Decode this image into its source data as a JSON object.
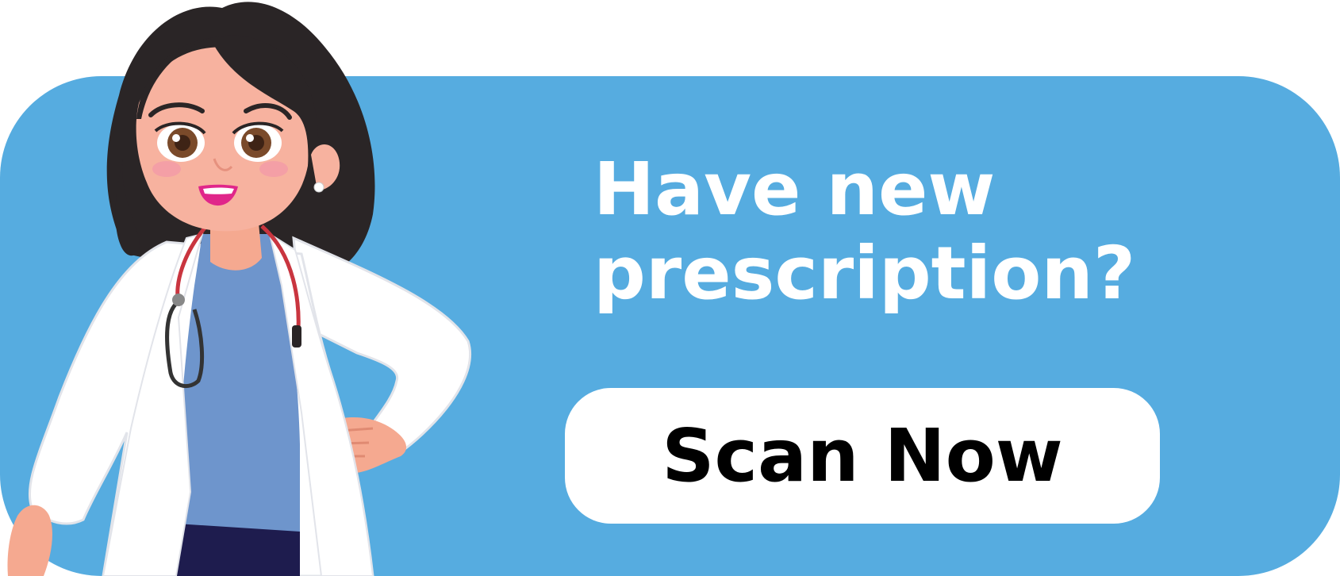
{
  "banner": {
    "headline_line1": "Have new",
    "headline_line2": "prescription?",
    "cta_label": "Scan Now",
    "background_color": "#56ACE0",
    "text_color": "#FFFFFF",
    "button_color": "#FFFFFF",
    "button_text_color": "#000000"
  },
  "illustration": {
    "icon": "doctor-illustration",
    "accessory_icon": "stethoscope-icon"
  }
}
